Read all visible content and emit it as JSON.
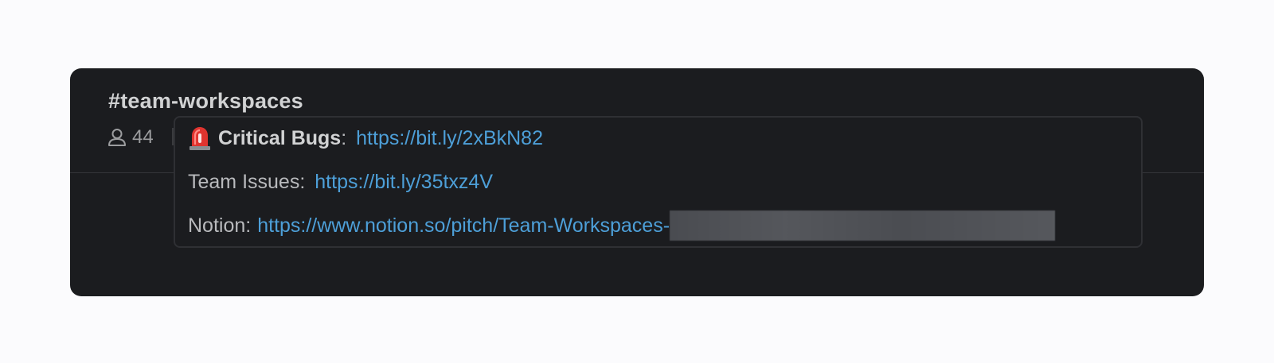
{
  "channel": {
    "name": "#team-workspaces",
    "member_icon": "person-icon",
    "member_count": "44"
  },
  "topic": {
    "line1": {
      "icon": "siren-icon",
      "label": "Critical Bugs",
      "separator": ":",
      "link": "https://bit.ly/2xBkN82"
    },
    "line2": {
      "label": "Team Issues:",
      "link": "https://bit.ly/35txz4V"
    },
    "line3": {
      "label": "Notion:",
      "link": "https://www.notion.so/pitch/Team-Workspaces-"
    }
  },
  "colors": {
    "panel_bg": "#1b1c1f",
    "link": "#4d9fd8",
    "text_primary": "#d1d2d3",
    "text_secondary": "#9c9d9f"
  }
}
